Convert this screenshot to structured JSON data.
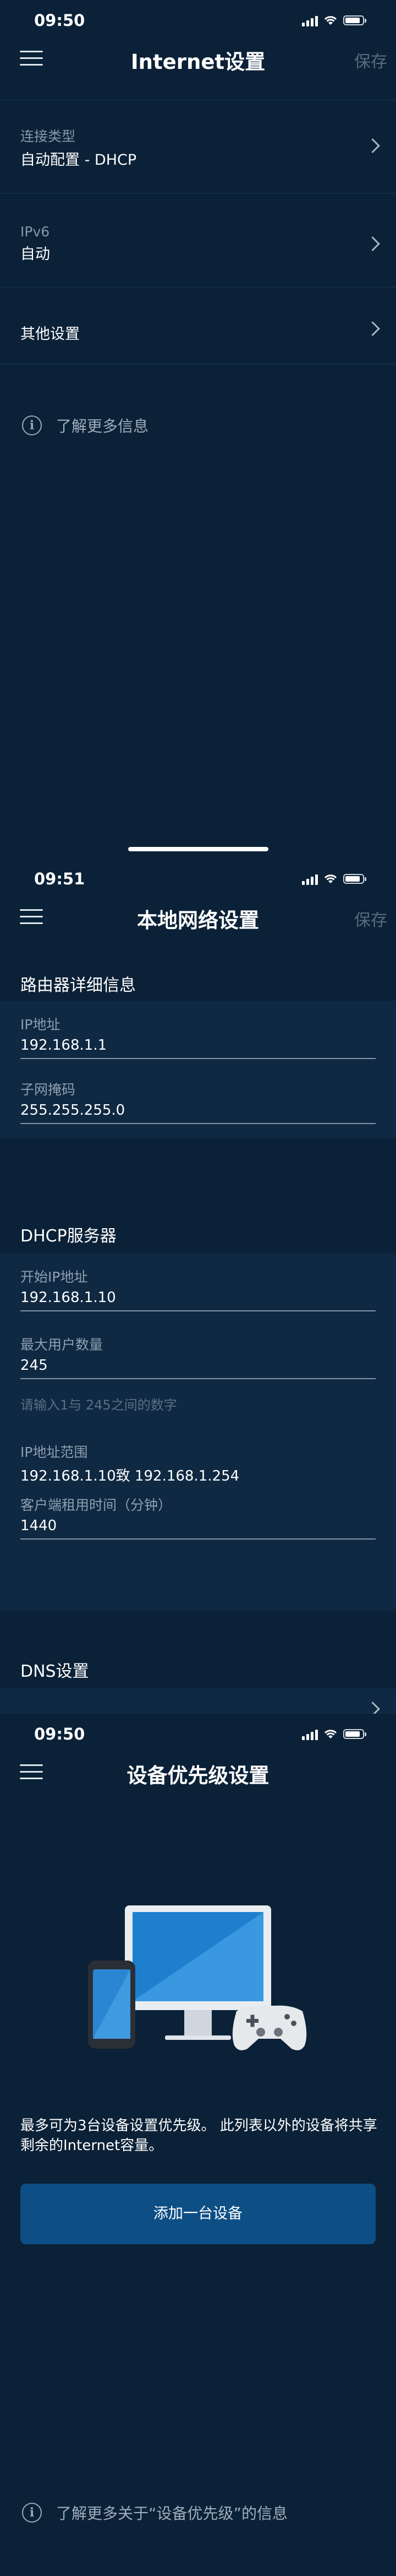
{
  "screen1": {
    "status_time": "09:50",
    "nav": {
      "title": "Internet设置",
      "save": "保存"
    },
    "rows": [
      {
        "label": "连接类型",
        "value": "自动配置 - DHCP"
      },
      {
        "label": "IPv6",
        "value": "自动"
      },
      {
        "label": "其他设置",
        "value": ""
      }
    ],
    "info_link": "了解更多信息",
    "icons": [
      "menu-icon",
      "chevron-right-icon",
      "info-icon",
      "signal-icon",
      "wifi-icon",
      "battery-icon"
    ]
  },
  "screen2": {
    "status_time": "09:51",
    "nav": {
      "title": "本地网络设置",
      "save": "保存"
    },
    "router_section": {
      "title": "路由器详细信息",
      "ip_label": "IP地址",
      "ip_value": "192.168.1.1",
      "mask_label": "子网掩码",
      "mask_value": "255.255.255.0"
    },
    "dhcp_section": {
      "title": "DHCP服务器",
      "start_label": "开始IP地址",
      "start_value": "192.168.1.10",
      "max_label": "最大用户数量",
      "max_value": "245",
      "max_hint": "请输入1与 245之间的数字",
      "range_label": "IP地址范围",
      "range_value": "192.168.1.10致 192.168.1.254",
      "lease_label": "客户端租用时间（分钟）",
      "lease_value": "1440"
    },
    "dns_section": {
      "title": "DNS设置"
    }
  },
  "screen3": {
    "status_time": "09:50",
    "nav": {
      "title": "设备优先级设置"
    },
    "description": "最多可为3台设备设置优先级。 此列表以外的设备将共享剩余的Internet容量。",
    "add_button": "添加一台设备",
    "info_link": "了解更多关于“设备优先级”的信息"
  }
}
